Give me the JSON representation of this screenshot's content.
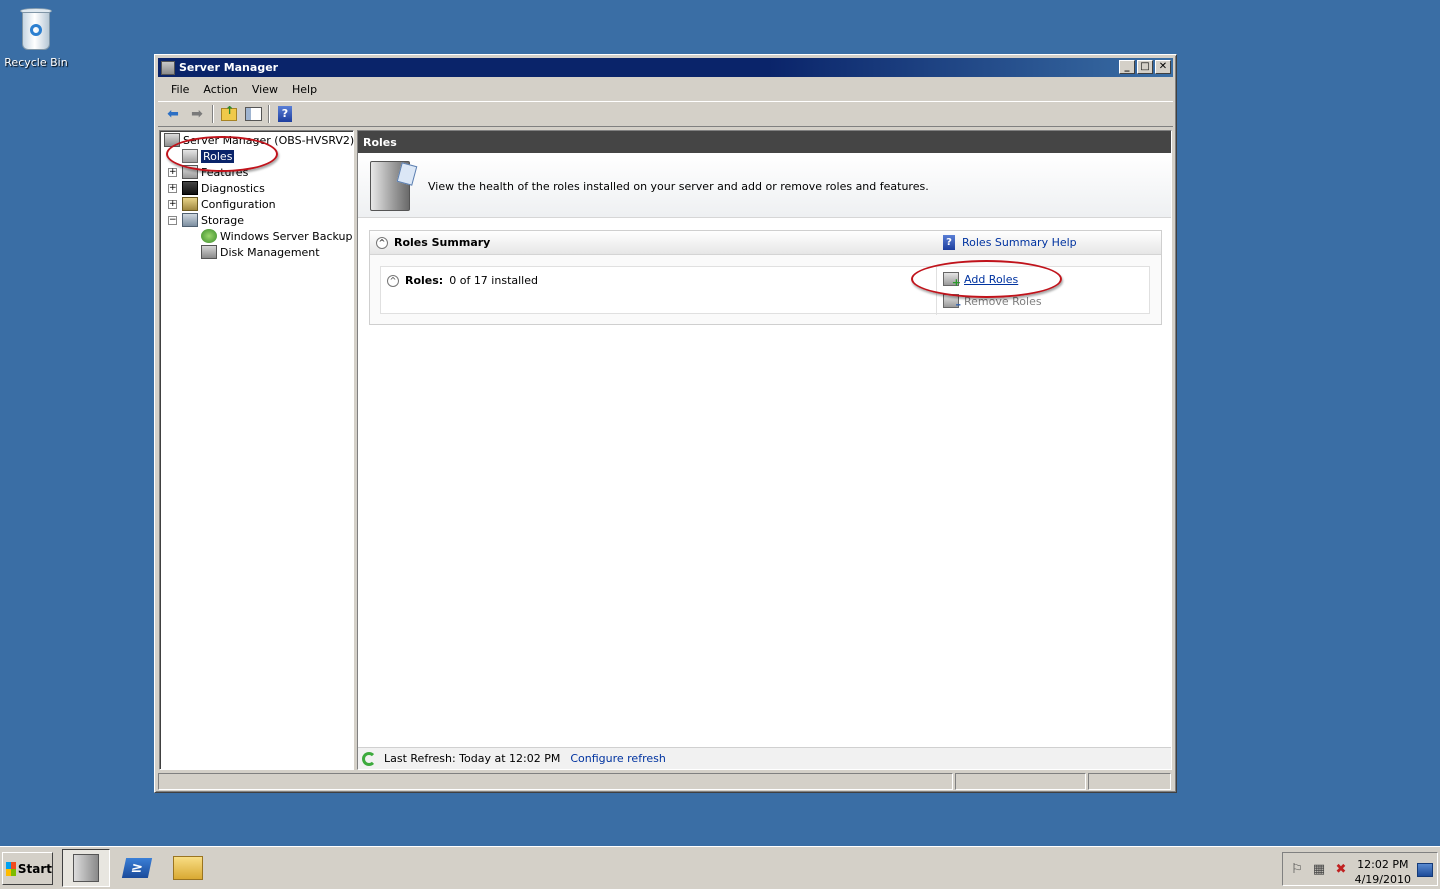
{
  "desktop": {
    "recycle_bin_label": "Recycle Bin"
  },
  "window": {
    "title": "Server Manager",
    "controls": {
      "minimize": "_",
      "maximize": "□",
      "close": "✕"
    },
    "menu": [
      "File",
      "Action",
      "View",
      "Help"
    ],
    "toolbar": {
      "icons": [
        "back-arrow-icon",
        "forward-arrow-icon",
        "up-folder-icon",
        "show-hide-tree-icon",
        "help-icon"
      ],
      "help_glyph": "?"
    }
  },
  "tree": {
    "items": [
      {
        "label": "Server Manager (OBS-HVSRV2)",
        "icon": "server-icon"
      },
      {
        "label": "Roles",
        "icon": "roles-icon",
        "selected": true
      },
      {
        "label": "Features",
        "icon": "features-icon",
        "expander": "+"
      },
      {
        "label": "Diagnostics",
        "icon": "diagnostics-icon",
        "expander": "+"
      },
      {
        "label": "Configuration",
        "icon": "configuration-icon",
        "expander": "+"
      },
      {
        "label": "Storage",
        "icon": "storage-icon",
        "expander": "−"
      },
      {
        "label": "Windows Server Backup",
        "icon": "backup-icon"
      },
      {
        "label": "Disk Management",
        "icon": "disk-icon"
      }
    ]
  },
  "content": {
    "header": "Roles",
    "intro_text": "View the health of the roles installed on your server and add or remove roles and features.",
    "section": {
      "title": "Roles Summary",
      "help_link": "Roles Summary Help",
      "help_glyph": "?",
      "roles_label": "Roles:",
      "roles_value": "0 of 17 installed",
      "tasks": {
        "add": "Add Roles",
        "remove": "Remove Roles"
      },
      "collapse_glyph": "^"
    },
    "footer": {
      "last_refresh": "Last Refresh: Today at 12:02 PM",
      "configure_link": "Configure refresh"
    }
  },
  "taskbar": {
    "start_label": "Start",
    "powershell_glyph": "≥",
    "clock_time": "12:02 PM",
    "clock_date": "4/19/2010",
    "tray_icons": [
      "flag-icon",
      "network-icon",
      "volume-muted-icon"
    ]
  },
  "colors": {
    "desktop": "#3a6ea5",
    "titlebar": "#0a246a",
    "link": "#0033a0",
    "annotation": "#c0131b"
  }
}
